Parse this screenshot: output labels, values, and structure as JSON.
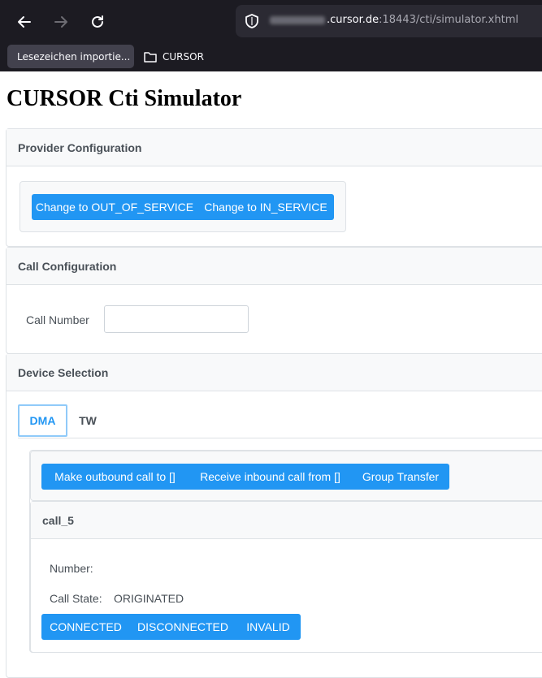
{
  "browser": {
    "url_host": ".cursor.de",
    "url_rest": ":18443/cti/simulator.xhtml",
    "bookmarks": [
      {
        "label": "Lesezeichen importie..."
      },
      {
        "label": "CURSOR"
      }
    ]
  },
  "page": {
    "title": "CURSOR Cti Simulator"
  },
  "provider_configuration": {
    "header": "Provider Configuration",
    "buttons": [
      "Change to OUT_OF_SERVICE",
      "Change to IN_SERVICE"
    ]
  },
  "call_configuration": {
    "header": "Call Configuration",
    "call_number_label": "Call Number",
    "call_number_value": ""
  },
  "device_selection": {
    "header": "Device Selection",
    "tabs": [
      {
        "label": "DMA",
        "active": true
      },
      {
        "label": "TW",
        "active": false
      }
    ],
    "actions": [
      "Make outbound call to []",
      "Receive inbound call from []",
      "Group Transfer"
    ],
    "call": {
      "header": "call_5",
      "number_label": "Number:",
      "number_value": "",
      "state_label": "Call State:",
      "state_value": "ORIGINATED",
      "state_buttons": [
        "CONNECTED",
        "DISCONNECTED",
        "INVALID"
      ]
    }
  }
}
